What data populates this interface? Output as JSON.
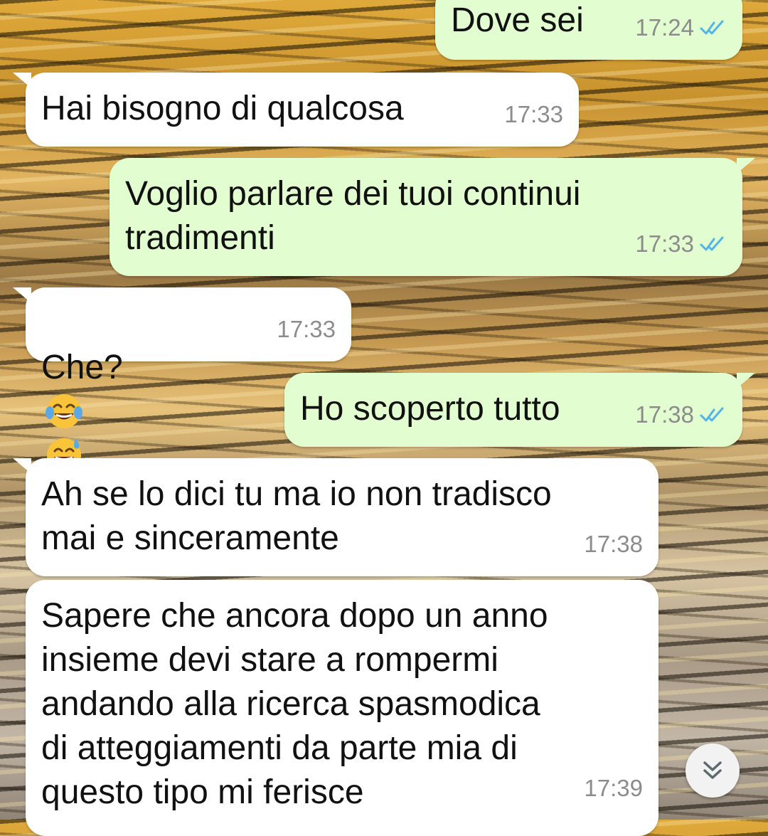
{
  "chat": {
    "messages": [
      {
        "direction": "out",
        "text": "Dove sei",
        "time": "17:24",
        "status": "read"
      },
      {
        "direction": "in",
        "text": "Hai bisogno di qualcosa",
        "time": "17:33"
      },
      {
        "direction": "out",
        "text": "Voglio parlare dei tuoi continui\ntradimenti",
        "time": "17:33",
        "status": "read"
      },
      {
        "direction": "in",
        "text": "Che?",
        "emojis": [
          "face-with-tears-of-joy",
          "grinning-face-with-sweat"
        ],
        "time": "17:33"
      },
      {
        "direction": "out",
        "text": "Ho scoperto tutto",
        "time": "17:38",
        "status": "read"
      },
      {
        "direction": "in",
        "text": "Ah se lo dici tu ma io non tradisco\nmai e sinceramente",
        "time": "17:38"
      },
      {
        "direction": "in",
        "text": "Sapere che ancora dopo un anno\ninsieme devi stare a rompermi\nandando alla ricerca spasmodica\ndi atteggiamenti da parte mia di\nquesto tipo mi ferisce",
        "time": "17:39"
      }
    ]
  },
  "scroll_button": {
    "icon": "double-chevron-down-icon"
  },
  "colors": {
    "incoming_bubble": "#ffffff",
    "outgoing_bubble": "#e2fdcf",
    "timestamp": "#8c8c8c",
    "read_tick": "#4fb6ec"
  }
}
